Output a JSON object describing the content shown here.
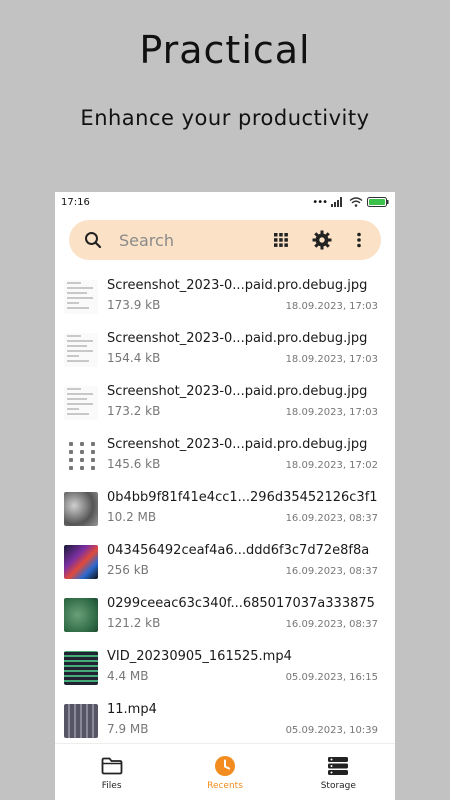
{
  "promo": {
    "title": "Practical",
    "subtitle": "Enhance your productivity"
  },
  "statusbar": {
    "time": "17:16",
    "battery_level_percent": 100
  },
  "search": {
    "placeholder": "Search"
  },
  "files": [
    {
      "name": "Screenshot_2023-0...paid.pro.debug.jpg",
      "size": "173.9 kB",
      "date": "18.09.2023, 17:03",
      "thumb": "doc"
    },
    {
      "name": "Screenshot_2023-0...paid.pro.debug.jpg",
      "size": "154.4 kB",
      "date": "18.09.2023, 17:03",
      "thumb": "doc"
    },
    {
      "name": "Screenshot_2023-0...paid.pro.debug.jpg",
      "size": "173.2 kB",
      "date": "18.09.2023, 17:03",
      "thumb": "doc"
    },
    {
      "name": "Screenshot_2023-0...paid.pro.debug.jpg",
      "size": "145.6 kB",
      "date": "18.09.2023, 17:02",
      "thumb": "grid"
    },
    {
      "name": "0b4bb9f81f41e4cc1...296d35452126c3f1",
      "size": "10.2 MB",
      "date": "16.09.2023, 08:37",
      "thumb": "gray"
    },
    {
      "name": "043456492ceaf4a6...ddd6f3c7d72e8f8a",
      "size": "256 kB",
      "date": "16.09.2023, 08:37",
      "thumb": "colorful"
    },
    {
      "name": "0299ceeac63c340f...685017037a333875",
      "size": "121.2 kB",
      "date": "16.09.2023, 08:37",
      "thumb": "green"
    },
    {
      "name": "VID_20230905_161525.mp4",
      "size": "4.4 MB",
      "date": "05.09.2023, 16:15",
      "thumb": "keyboard"
    },
    {
      "name": "11.mp4",
      "size": "7.9 MB",
      "date": "05.09.2023, 10:39",
      "thumb": "keyboard2"
    }
  ],
  "bottom_nav": [
    {
      "label": "Files",
      "icon": "folder-icon",
      "active": false
    },
    {
      "label": "Recents",
      "icon": "clock-icon",
      "active": true
    },
    {
      "label": "Storage",
      "icon": "storage-icon",
      "active": false
    }
  ],
  "colors": {
    "accent": "#f28c1e",
    "search_bg": "#fbe1c6"
  }
}
